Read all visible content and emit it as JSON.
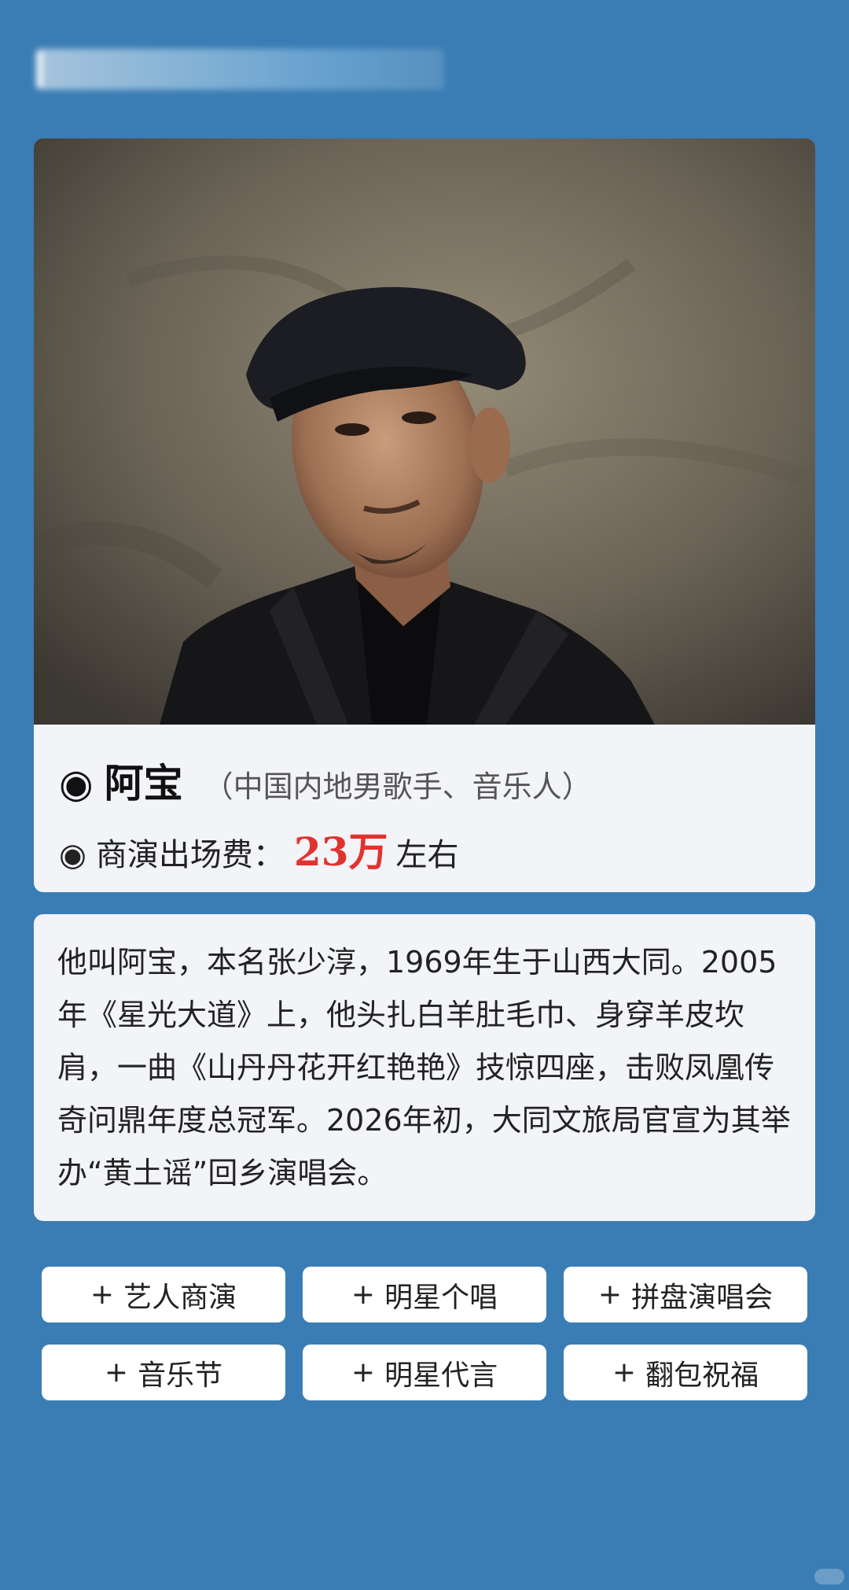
{
  "profile": {
    "bullet": "◉",
    "name": "阿宝",
    "description": "（中国内地男歌手、音乐人）",
    "fee_label": "商演出场费：",
    "fee_value": "23万",
    "fee_suffix": "左右"
  },
  "bio": {
    "text": "他叫阿宝，本名张少淳，1969年生于山西大同。2005年《星光大道》上，他头扎白羊肚毛巾、身穿羊皮坎肩，一曲《山丹丹花开红艳艳》技惊四座，击败凤凰传奇问鼎年度总冠军。2026年初，大同文旅局官宣为其举办“黄土谣”回乡演唱会。"
  },
  "tags": [
    {
      "plus": "+",
      "label": "艺人商演"
    },
    {
      "plus": "+",
      "label": "明星个唱"
    },
    {
      "plus": "+",
      "label": "拼盘演唱会"
    },
    {
      "plus": "+",
      "label": "音乐节"
    },
    {
      "plus": "+",
      "label": "明星代言"
    },
    {
      "plus": "+",
      "label": "翻包祝福"
    }
  ],
  "colors": {
    "background": "#3a7db4",
    "card": "#f2f4f8",
    "fee_accent": "#e2322f"
  }
}
